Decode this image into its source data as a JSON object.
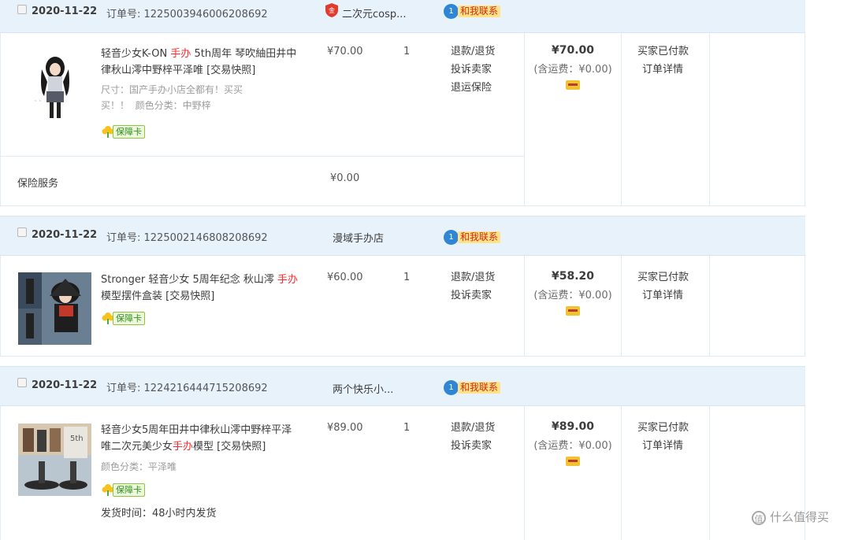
{
  "orders": [
    {
      "date": "2020-11-22",
      "order_no": "订单号: 1225003946006208692",
      "shop": "二次元cosp...",
      "shop_badge": "金",
      "contact_label": "和我联系",
      "contact_count": "1",
      "item_title_a": "轻音少女K-ON ",
      "item_title_hl": "手办",
      "item_title_b": " 5th周年 琴吹紬田井中律秋山澪中野梓平泽唯 [交易快照]",
      "sku_1": "尺寸：国产手办小店全都有！买买买！！",
      "sku_2": "颜色分类：中野梓",
      "guarantee": "保障卡",
      "price": "¥70.00",
      "qty": "1",
      "ops": [
        "退款/退货",
        "投诉卖家",
        "退运保险"
      ],
      "total": "¥70.00",
      "shipping": "(含运费：¥0.00)",
      "status": [
        "买家已付款",
        "订单详情"
      ],
      "insurance_label": "保险服务",
      "insurance_price": "¥0.00"
    },
    {
      "date": "2020-11-22",
      "order_no": "订单号: 1225002146808208692",
      "shop": "漫域手办店",
      "contact_label": "和我联系",
      "contact_count": "1",
      "item_title_a": "Stronger 轻音少女 5周年纪念 秋山澪 ",
      "item_title_hl": "手办",
      "item_title_b": "模型摆件盒装 [交易快照]",
      "guarantee": "保障卡",
      "price": "¥60.00",
      "qty": "1",
      "ops": [
        "退款/退货",
        "投诉卖家"
      ],
      "total": "¥58.20",
      "shipping": "(含运费：¥0.00)",
      "status": [
        "买家已付款",
        "订单详情"
      ]
    },
    {
      "date": "2020-11-22",
      "order_no": "订单号: 1224216444715208692",
      "shop": "两个快乐小...",
      "contact_label": "和我联系",
      "contact_count": "1",
      "item_title_a": "轻音少女5周年田井中律秋山澪中野梓平泽唯二次元美少女",
      "item_title_hl": "手办",
      "item_title_b": "模型 [交易快照]",
      "sku_1": "颜色分类：平泽唯",
      "guarantee": "保障卡",
      "ship_note": "发货时间：48小时内发货",
      "price": "¥89.00",
      "qty": "1",
      "ops": [
        "退款/退货",
        "投诉卖家"
      ],
      "total": "¥89.00",
      "shipping": "(含运费：¥0.00)",
      "status": [
        "买家已付款",
        "订单详情"
      ]
    }
  ],
  "watermark": {
    "logo": "值",
    "text": "什么值得买"
  },
  "colors": {
    "header_bg": "#e8f2fb",
    "highlight_red": "#ff2b2b",
    "contact_bg": "#ffe28a",
    "border": "#e1ebf4"
  }
}
